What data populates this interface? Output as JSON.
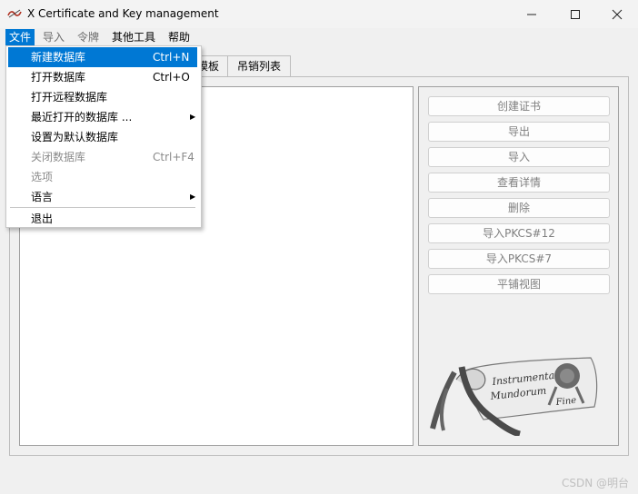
{
  "window": {
    "title": "X Certificate and Key management"
  },
  "menubar": {
    "items": [
      {
        "label": "文件",
        "state": "active"
      },
      {
        "label": "导入",
        "state": "disabled"
      },
      {
        "label": "令牌",
        "state": "disabled"
      },
      {
        "label": "其他工具",
        "state": "normal"
      },
      {
        "label": "帮助",
        "state": "normal"
      }
    ]
  },
  "tabs": [
    {
      "label": "模板"
    },
    {
      "label": "吊销列表"
    }
  ],
  "file_menu": {
    "items": [
      {
        "label": "新建数据库",
        "shortcut": "Ctrl+N",
        "selected": true
      },
      {
        "label": "打开数据库",
        "shortcut": "Ctrl+O"
      },
      {
        "label": "打开远程数据库",
        "shortcut": ""
      },
      {
        "label": "最近打开的数据库 ...",
        "shortcut": "",
        "submenu": true
      },
      {
        "label": "设置为默认数据库",
        "shortcut": ""
      },
      {
        "label": "关闭数据库",
        "shortcut": "Ctrl+F4",
        "disabled": true
      },
      {
        "label": "选项",
        "shortcut": "",
        "disabled": true
      },
      {
        "label": "语言",
        "shortcut": "",
        "submenu": true
      },
      {
        "label": "退出",
        "shortcut": ""
      }
    ]
  },
  "actions": [
    {
      "label": "创建证书"
    },
    {
      "label": "导出"
    },
    {
      "label": "导入"
    },
    {
      "label": "查看详情"
    },
    {
      "label": "删除"
    },
    {
      "label": "导入PKCS#12"
    },
    {
      "label": "导入PKCS#7"
    },
    {
      "label": "平铺视图"
    }
  ],
  "logo_text": "Instrumenta Mundorum Fine",
  "watermark": "CSDN @明台",
  "colors": {
    "accent": "#0078d4",
    "disabled_text": "#808080"
  }
}
